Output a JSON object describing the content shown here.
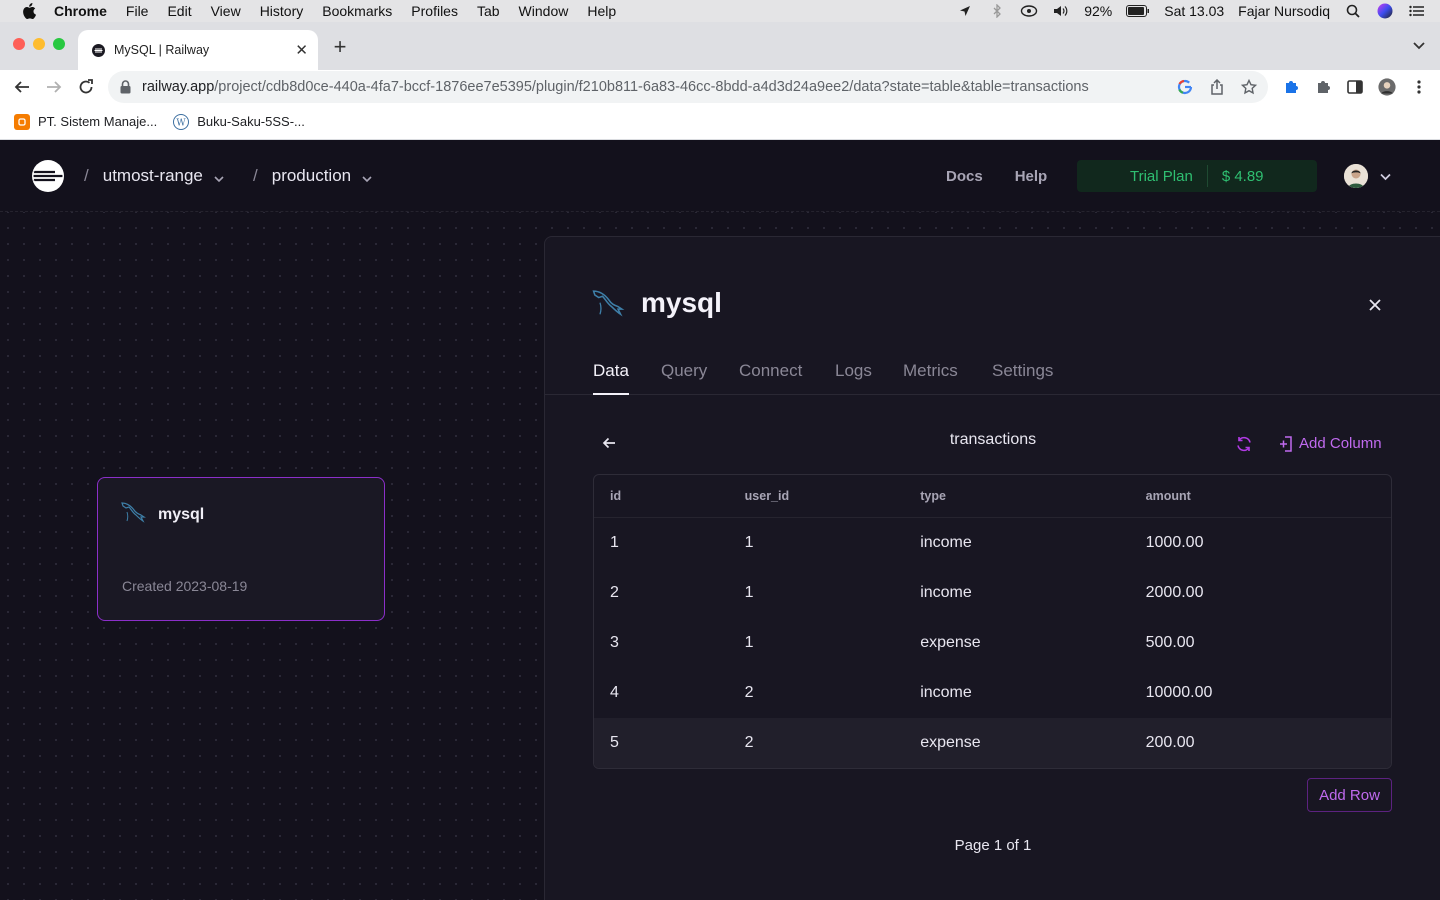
{
  "menubar": {
    "app": "Chrome",
    "items": [
      "File",
      "Edit",
      "View",
      "History",
      "Bookmarks",
      "Profiles",
      "Tab",
      "Window",
      "Help"
    ],
    "battery": "92%",
    "clock": "Sat 13.03",
    "user": "Fajar Nursodiq"
  },
  "browser": {
    "tab_title": "MySQL | Railway",
    "url_host": "railway.app",
    "url_path": "/project/cdb8d0ce-440a-4fa7-bccf-1876ee7e5395/plugin/f210b811-6a83-46cc-8bdd-a4d3d24a9ee2/data?state=table&table=transactions",
    "bookmarks": [
      "PT. Sistem Manaje...",
      "Buku-Saku-5SS-..."
    ]
  },
  "nav": {
    "project": "utmost-range",
    "environment": "production",
    "docs": "Docs",
    "help": "Help",
    "plan": "Trial Plan",
    "credit": "$ 4.89"
  },
  "card": {
    "name": "mysql",
    "created": "Created 2023-08-19"
  },
  "panel": {
    "title": "mysql",
    "tabs": [
      "Data",
      "Query",
      "Connect",
      "Logs",
      "Metrics",
      "Settings"
    ],
    "active_tab": "Data",
    "table_name": "transactions",
    "add_column": "Add Column",
    "columns": [
      "id",
      "user_id",
      "type",
      "amount"
    ],
    "rows": [
      [
        "1",
        "1",
        "income",
        "1000.00"
      ],
      [
        "2",
        "1",
        "income",
        "2000.00"
      ],
      [
        "3",
        "1",
        "expense",
        "500.00"
      ],
      [
        "4",
        "2",
        "income",
        "10000.00"
      ],
      [
        "5",
        "2",
        "expense",
        "200.00"
      ]
    ],
    "add_row": "Add Row",
    "pagination": "Page 1 of 1"
  },
  "colors": {
    "accent": "#c06aef",
    "card_border": "#8b2fc9",
    "plan_text": "#2fbf71",
    "background": "#13111c"
  }
}
